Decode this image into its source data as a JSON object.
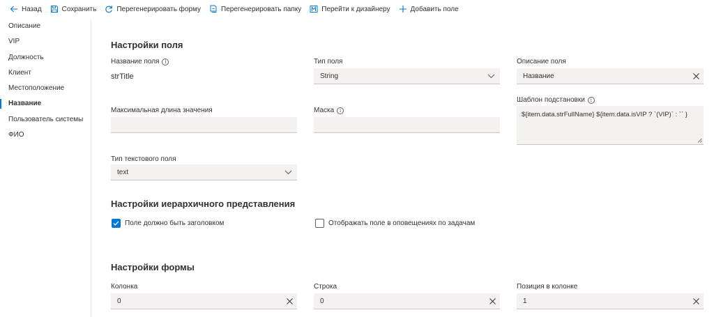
{
  "toolbar": {
    "back": "Назад",
    "save": "Сохранить",
    "regen_form": "Перегенерировать форму",
    "regen_folder": "Перегенерировать папку",
    "to_designer": "Перейти к дизайнеру",
    "add_field": "Добавить поле"
  },
  "sidebar": {
    "items": [
      {
        "label": "Описание"
      },
      {
        "label": "VIP"
      },
      {
        "label": "Должность"
      },
      {
        "label": "Клиент"
      },
      {
        "label": "Местоположение"
      },
      {
        "label": "Название",
        "active": true
      },
      {
        "label": "Пользователь системы"
      },
      {
        "label": "ФИО"
      }
    ]
  },
  "field_settings": {
    "heading": "Настройки поля",
    "name_label": "Название поля",
    "name_value": "strTitle",
    "type_label": "Тип поля",
    "type_value": "String",
    "desc_label": "Описание поля",
    "desc_value": "Название",
    "template_label": "Шаблон подстановки",
    "template_value": "${item.data.strFullName} ${item.data.isVIP ? `(VIP)` : `` }",
    "maxlen_label": "Максимальная длина значения",
    "maxlen_value": "",
    "mask_label": "Маска",
    "mask_value": "",
    "textfield_type_label": "Тип текстового поля",
    "textfield_type_value": "text"
  },
  "hierarchy": {
    "heading": "Настройки иерархичного представления",
    "is_title_label": "Поле должно быть заголовком",
    "is_title_checked": true,
    "show_in_notifications_label": "Отображать поле в оповещениях по задачам",
    "show_in_notifications_checked": false
  },
  "form_settings": {
    "heading": "Настройки формы",
    "column_label": "Колонка",
    "column_value": "0",
    "row_label": "Строка",
    "row_value": "0",
    "position_label": "Позиция в колонке",
    "position_value": "1"
  },
  "colors": {
    "accent": "#0078d4",
    "field_bg": "#f3f2f1",
    "text": "#323130"
  }
}
